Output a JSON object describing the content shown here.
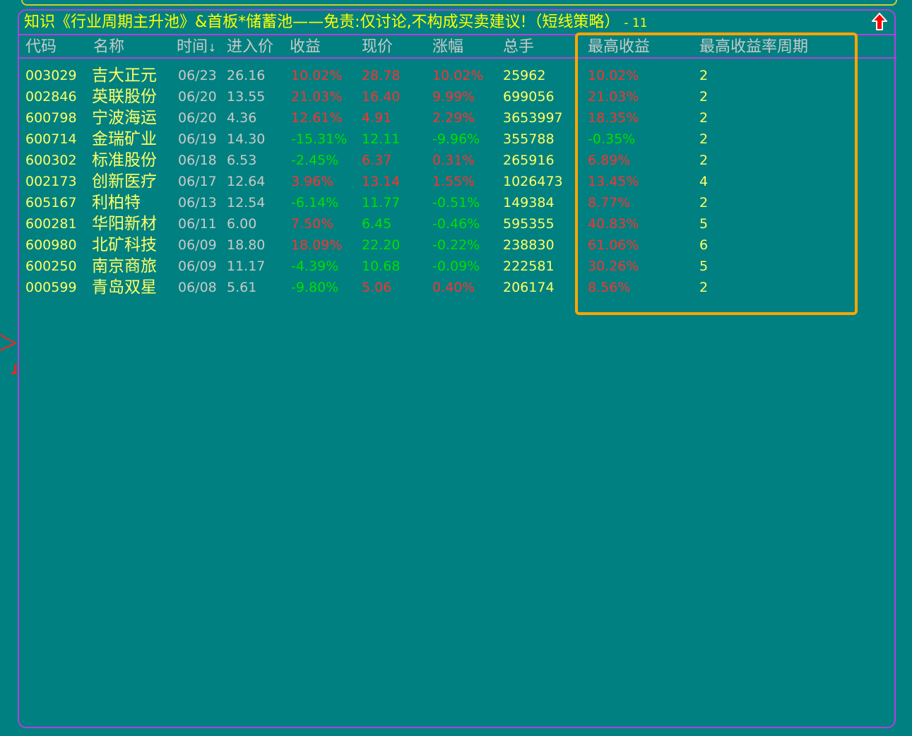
{
  "title": {
    "text": "知识《行业周期主升池》&首板*储蓄池——免责:仅讨论,不构成买卖建议!（短线策略）",
    "count": "- 11"
  },
  "colors": {
    "background": "#008080",
    "border": "#b040e0",
    "highlight": "#ffa500",
    "up": "#ff3030",
    "down": "#00e000",
    "text_yellow": "#ffff66"
  },
  "icons": {
    "scroll_top": "red-up-arrow-icon",
    "left_marker": "red-chevron-icon"
  },
  "headers": {
    "code": "代码",
    "name": "名称",
    "time": "时间",
    "time_sort": "↓",
    "entry_price": "进入价",
    "return": "收益",
    "current_price": "现价",
    "change": "涨幅",
    "volume": "总手",
    "max_return": "最高收益",
    "max_return_period": "最高收益率周期"
  },
  "rows": [
    {
      "code": "003029",
      "name": "吉大正元",
      "date": "06/23",
      "entry": "26.16",
      "ret": "10.02%",
      "ret_dir": "red",
      "price": "28.78",
      "price_dir": "red",
      "chg": "10.02%",
      "chg_dir": "red",
      "vol": "25962",
      "max_ret": "10.02%",
      "max_dir": "red",
      "period": "2"
    },
    {
      "code": "002846",
      "name": "英联股份",
      "date": "06/20",
      "entry": "13.55",
      "ret": "21.03%",
      "ret_dir": "red",
      "price": "16.40",
      "price_dir": "red",
      "chg": "9.99%",
      "chg_dir": "red",
      "vol": "699056",
      "max_ret": "21.03%",
      "max_dir": "red",
      "period": "2"
    },
    {
      "code": "600798",
      "name": "宁波海运",
      "date": "06/20",
      "entry": "4.36",
      "ret": "12.61%",
      "ret_dir": "red",
      "price": "4.91",
      "price_dir": "red",
      "chg": "2.29%",
      "chg_dir": "red",
      "vol": "3653997",
      "max_ret": "18.35%",
      "max_dir": "red",
      "period": "2"
    },
    {
      "code": "600714",
      "name": "金瑞矿业",
      "date": "06/19",
      "entry": "14.30",
      "ret": "-15.31%",
      "ret_dir": "green",
      "price": "12.11",
      "price_dir": "green",
      "chg": "-9.96%",
      "chg_dir": "green",
      "vol": "355788",
      "max_ret": "-0.35%",
      "max_dir": "green",
      "period": "2"
    },
    {
      "code": "600302",
      "name": "标准股份",
      "date": "06/18",
      "entry": "6.53",
      "ret": "-2.45%",
      "ret_dir": "green",
      "price": "6.37",
      "price_dir": "red",
      "chg": "0.31%",
      "chg_dir": "red",
      "vol": "265916",
      "max_ret": "6.89%",
      "max_dir": "red",
      "period": "2"
    },
    {
      "code": "002173",
      "name": "创新医疗",
      "date": "06/17",
      "entry": "12.64",
      "ret": "3.96%",
      "ret_dir": "red",
      "price": "13.14",
      "price_dir": "red",
      "chg": "1.55%",
      "chg_dir": "red",
      "vol": "1026473",
      "max_ret": "13.45%",
      "max_dir": "red",
      "period": "4"
    },
    {
      "code": "605167",
      "name": "利柏特",
      "date": "06/13",
      "entry": "12.54",
      "ret": "-6.14%",
      "ret_dir": "green",
      "price": "11.77",
      "price_dir": "green",
      "chg": "-0.51%",
      "chg_dir": "green",
      "vol": "149384",
      "max_ret": "8.77%",
      "max_dir": "red",
      "period": "2"
    },
    {
      "code": "600281",
      "name": "华阳新材",
      "date": "06/11",
      "entry": "6.00",
      "ret": "7.50%",
      "ret_dir": "red",
      "price": "6.45",
      "price_dir": "green",
      "chg": "-0.46%",
      "chg_dir": "green",
      "vol": "595355",
      "max_ret": "40.83%",
      "max_dir": "red",
      "period": "5"
    },
    {
      "code": "600980",
      "name": "北矿科技",
      "date": "06/09",
      "entry": "18.80",
      "ret": "18.09%",
      "ret_dir": "red",
      "price": "22.20",
      "price_dir": "green",
      "chg": "-0.22%",
      "chg_dir": "green",
      "vol": "238830",
      "max_ret": "61.06%",
      "max_dir": "red",
      "period": "6"
    },
    {
      "code": "600250",
      "name": "南京商旅",
      "date": "06/09",
      "entry": "11.17",
      "ret": "-4.39%",
      "ret_dir": "green",
      "price": "10.68",
      "price_dir": "green",
      "chg": "-0.09%",
      "chg_dir": "green",
      "vol": "222581",
      "max_ret": "30.26%",
      "max_dir": "red",
      "period": "5"
    },
    {
      "code": "000599",
      "name": "青岛双星",
      "date": "06/08",
      "entry": "5.61",
      "ret": "-9.80%",
      "ret_dir": "green",
      "price": "5.06",
      "price_dir": "red",
      "chg": "0.40%",
      "chg_dir": "red",
      "vol": "206174",
      "max_ret": "8.56%",
      "max_dir": "red",
      "period": "2"
    }
  ]
}
